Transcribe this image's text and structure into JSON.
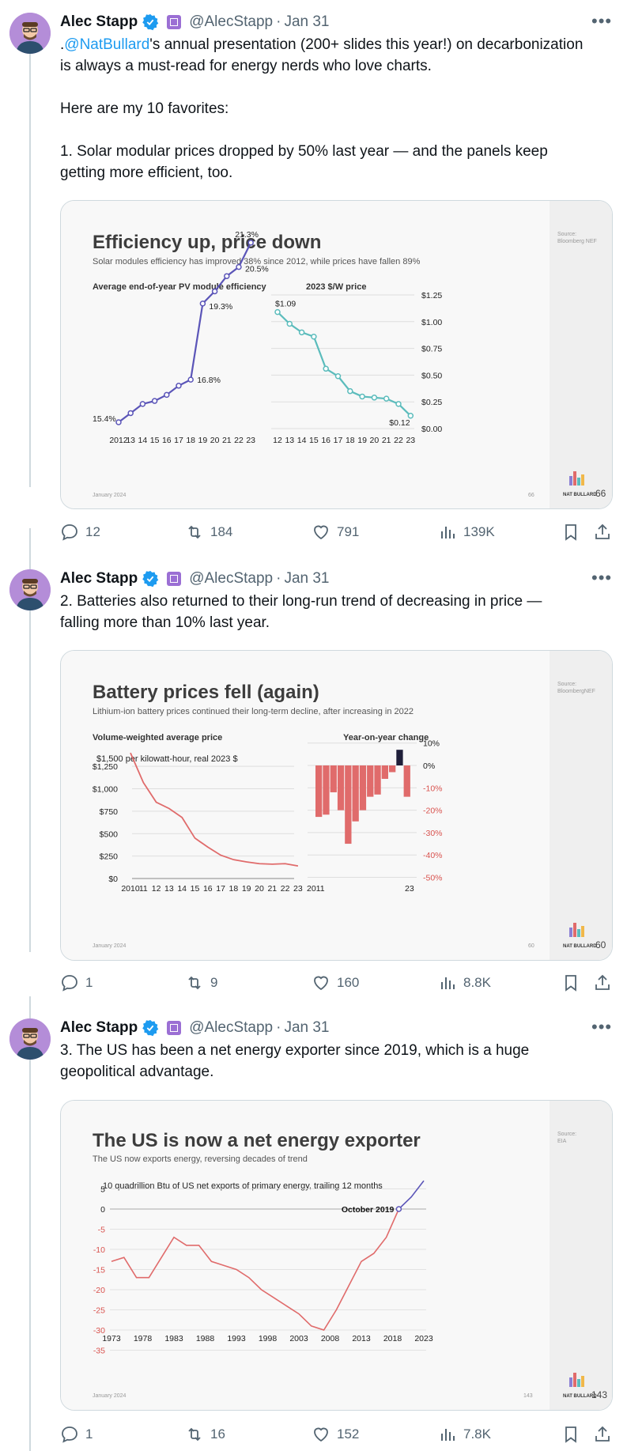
{
  "author": {
    "name": "Alec Stapp",
    "handle": "@AlecStapp"
  },
  "tweets": [
    {
      "date": "Jan 31",
      "mention": "@NatBullard",
      "line1_rest": "'s annual presentation (200+ slides this year!) on decarbonization",
      "line1_prefix": ".",
      "line2": "is always a must-read for energy nerds who love charts.",
      "line3": "Here are my 10 favorites:",
      "line4": "1. Solar modular prices dropped by 50% last year — and the panels keep",
      "line5": "getting more efficient, too.",
      "stats": {
        "replies": "12",
        "reposts": "184",
        "likes": "791",
        "views": "139K"
      }
    },
    {
      "date": "Jan 31",
      "line1": "2. Batteries also returned to their long-run trend of decreasing in price —",
      "line2": "falling more than 10% last year.",
      "stats": {
        "replies": "1",
        "reposts": "9",
        "likes": "160",
        "views": "8.8K"
      }
    },
    {
      "date": "Jan 31",
      "line1": "3. The US has been a net energy exporter since 2019, which is a huge",
      "line2": "geopolitical advantage.",
      "stats": {
        "replies": "1",
        "reposts": "16",
        "likes": "152",
        "views": "7.8K"
      }
    }
  ],
  "slides": {
    "solar": {
      "title": "Efficiency up, price down",
      "subtitle": "Solar modules efficiency has improved 38% since 2012, while prices have fallen 89%",
      "left_label": "Average end-of-year PV module efficiency",
      "right_label": "2023 $/W price",
      "source": "Source:",
      "source2": "Bloomberg NEF",
      "date": "January 2024",
      "page": "66",
      "brand": "NAT BULLARD",
      "bigpage": "66",
      "eff_labels": [
        "15.4%",
        "16.8%",
        "19.3%",
        "20.5%",
        "21.3%"
      ],
      "price_labels": [
        "$1.09",
        "$0.12"
      ],
      "right_axis": [
        "$1.25",
        "$1.00",
        "$0.75",
        "$0.50",
        "$0.25",
        "$0.00"
      ],
      "x_left": [
        "2012",
        "13",
        "14",
        "15",
        "16",
        "17",
        "18",
        "19",
        "20",
        "21",
        "22",
        "23"
      ],
      "x_right": [
        "12",
        "13",
        "14",
        "15",
        "16",
        "17",
        "18",
        "19",
        "20",
        "21",
        "22",
        "23"
      ]
    },
    "battery": {
      "title": "Battery prices fell (again)",
      "subtitle": "Lithium-ion battery prices continued their long-term decline, after increasing in 2022",
      "left_label": "Volume-weighted average price",
      "right_label": "Year-on-year change",
      "unit": "$1,500 per kilowatt-hour, real 2023 $",
      "source": "Source:",
      "source2": "BloombergNEF",
      "date": "January 2024",
      "page": "60",
      "brand": "NAT BULLARD",
      "bigpage": "60",
      "left_axis": [
        "$1,250",
        "$1,000",
        "$750",
        "$500",
        "$250",
        "$0"
      ],
      "right_axis": [
        "10%",
        "0%",
        "-10%",
        "-20%",
        "-30%",
        "-40%",
        "-50%"
      ],
      "x_left": [
        "2010",
        "11",
        "12",
        "13",
        "14",
        "15",
        "16",
        "17",
        "18",
        "19",
        "20",
        "21",
        "22",
        "23"
      ],
      "x_right": [
        "2011",
        "23"
      ]
    },
    "energy": {
      "title": "The US is now a net energy exporter",
      "subtitle": "The US now exports energy, reversing decades of trend",
      "unit": "10 quadrillion Btu of US net exports of primary energy, trailing 12 months",
      "annotation": "October 2019",
      "source": "Source:",
      "source2": "EIA",
      "date": "January 2024",
      "page": "143",
      "brand": "NAT BULLARD",
      "bigpage": "143",
      "y_axis": [
        "5",
        "0",
        "-5",
        "-10",
        "-15",
        "-20",
        "-25",
        "-30",
        "-35"
      ],
      "x_axis": [
        "1973",
        "1978",
        "1983",
        "1988",
        "1993",
        "1998",
        "2003",
        "2008",
        "2013",
        "2018",
        "2023"
      ]
    }
  },
  "chart_data": [
    {
      "type": "line",
      "title": "Efficiency up, price down",
      "ylabel": "Average end-of-year PV module efficiency",
      "x": [
        2012,
        2013,
        2014,
        2015,
        2016,
        2017,
        2018,
        2019,
        2020,
        2021,
        2022,
        2023
      ],
      "series": [
        {
          "name": "Average end-of-year PV module efficiency",
          "values": [
            15.4,
            15.7,
            16.0,
            16.1,
            16.3,
            16.6,
            16.8,
            19.3,
            19.7,
            20.2,
            20.5,
            21.3
          ]
        }
      ]
    },
    {
      "type": "line",
      "title": "2023 $/W price",
      "x": [
        2012,
        2013,
        2014,
        2015,
        2016,
        2017,
        2018,
        2019,
        2020,
        2021,
        2022,
        2023
      ],
      "ylim": [
        0,
        1.25
      ],
      "series": [
        {
          "name": "2023 $/W price",
          "values": [
            1.09,
            0.98,
            0.9,
            0.86,
            0.56,
            0.49,
            0.35,
            0.3,
            0.29,
            0.28,
            0.23,
            0.12
          ]
        }
      ]
    },
    {
      "type": "line",
      "title": "Battery prices fell (again)",
      "ylabel": "$1,500 per kilowatt-hour, real 2023 $",
      "x": [
        2010,
        2011,
        2012,
        2013,
        2014,
        2015,
        2016,
        2017,
        2018,
        2019,
        2020,
        2021,
        2022,
        2023
      ],
      "ylim": [
        0,
        1500
      ],
      "series": [
        {
          "name": "Volume-weighted average price",
          "values": [
            1400,
            1070,
            850,
            780,
            680,
            450,
            350,
            260,
            210,
            185,
            165,
            160,
            165,
            140
          ]
        }
      ]
    },
    {
      "type": "bar",
      "title": "Year-on-year change",
      "categories": [
        "2011",
        "2012",
        "2013",
        "2014",
        "2015",
        "2016",
        "2017",
        "2018",
        "2019",
        "2020",
        "2021",
        "2022",
        "2023"
      ],
      "ylim": [
        -50,
        10
      ],
      "values": [
        -23,
        -22,
        -12,
        -20,
        -35,
        -25,
        -20,
        -14,
        -13,
        -6,
        -3,
        7,
        -14
      ]
    },
    {
      "type": "line",
      "title": "The US is now a net energy exporter",
      "ylabel": "10 quadrillion Btu of US net exports of primary energy, trailing 12 months",
      "x": [
        1973,
        1975,
        1977,
        1979,
        1981,
        1983,
        1985,
        1987,
        1989,
        1991,
        1993,
        1995,
        1997,
        1999,
        2001,
        2003,
        2005,
        2007,
        2009,
        2011,
        2013,
        2015,
        2017,
        2019,
        2021,
        2023
      ],
      "ylim": [
        -35,
        5
      ],
      "series": [
        {
          "name": "US net exports",
          "values": [
            -13,
            -12,
            -17,
            -17,
            -12,
            -7,
            -9,
            -9,
            -13,
            -14,
            -15,
            -17,
            -20,
            -22,
            -24,
            -26,
            -29,
            -30,
            -25,
            -19,
            -13,
            -11,
            -7,
            0,
            3,
            7
          ]
        }
      ]
    }
  ]
}
